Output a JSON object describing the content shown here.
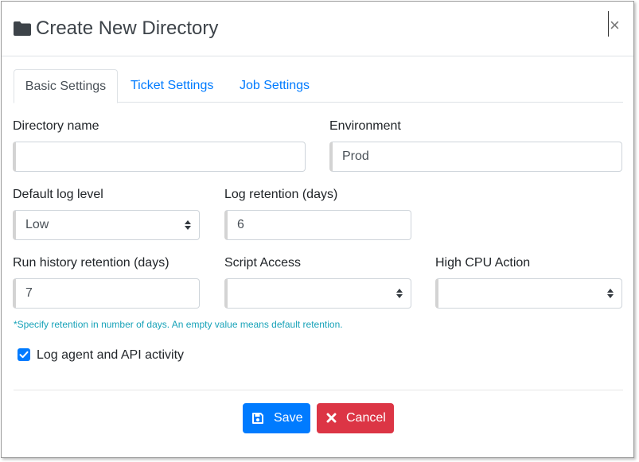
{
  "dialog": {
    "title": "Create New Directory",
    "close_label": "×"
  },
  "tabs": [
    {
      "label": "Basic Settings",
      "active": true
    },
    {
      "label": "Ticket Settings",
      "active": false
    },
    {
      "label": "Job Settings",
      "active": false
    }
  ],
  "form": {
    "directory_name": {
      "label": "Directory name",
      "value": ""
    },
    "environment": {
      "label": "Environment",
      "value": "Prod"
    },
    "default_log_level": {
      "label": "Default log level",
      "value": "Low"
    },
    "log_retention": {
      "label": "Log retention (days)",
      "value": "6"
    },
    "run_history_retention": {
      "label": "Run history retention (days)",
      "value": "7"
    },
    "script_access": {
      "label": "Script Access",
      "value": ""
    },
    "high_cpu_action": {
      "label": "High CPU Action",
      "value": ""
    },
    "help_text": "*Specify retention in number of days. An empty value means default retention.",
    "log_activity": {
      "label": "Log agent and API activity",
      "checked": true
    }
  },
  "buttons": {
    "save": "Save",
    "cancel": "Cancel"
  },
  "colors": {
    "primary": "#007bff",
    "danger": "#dc3545",
    "help_text": "#17a2b8"
  },
  "icons": {
    "title": "folder-icon",
    "save": "floppy-disk-icon",
    "cancel": "x-icon",
    "select_caret": "sort-caret-icon"
  }
}
